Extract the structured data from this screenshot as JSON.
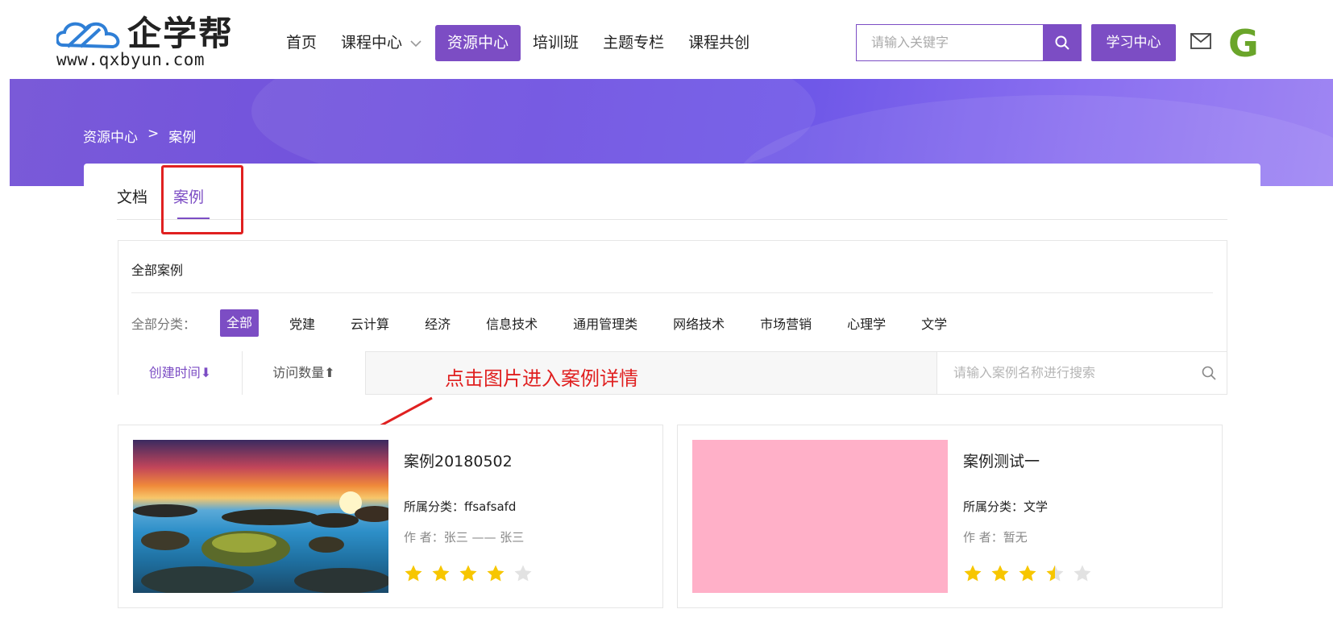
{
  "header": {
    "logo_text": "企学帮",
    "logo_url": "www.qxbyun.com",
    "nav": [
      {
        "label": "首页",
        "active": false
      },
      {
        "label": "课程中心",
        "active": false,
        "dropdown": true
      },
      {
        "label": "资源中心",
        "active": true
      },
      {
        "label": "培训班",
        "active": false
      },
      {
        "label": "主题专栏",
        "active": false
      },
      {
        "label": "课程共创",
        "active": false
      }
    ],
    "search_placeholder": "请输入关键字",
    "study_center_label": "学习中心",
    "avatar_letter": "G"
  },
  "breadcrumb": {
    "root": "资源中心",
    "separator": ">",
    "current": "案例"
  },
  "tabs": [
    {
      "label": "文档",
      "active": false
    },
    {
      "label": "案例",
      "active": true
    }
  ],
  "filter": {
    "title": "全部案例",
    "category_label": "全部分类：",
    "categories": [
      "全部",
      "党建",
      "云计算",
      "经济",
      "信息技术",
      "通用管理类",
      "网络技术",
      "市场营销",
      "心理学",
      "文学"
    ],
    "active_category": "全部"
  },
  "sort": {
    "created_time": "创建时间⬇",
    "visit_count": "访问数量⬆",
    "search_placeholder": "请输入案例名称进行搜索"
  },
  "annotation": {
    "text": "点击图片进入案例详情",
    "color": "#e02020"
  },
  "cases": [
    {
      "title": "案例20180502",
      "category": "所属分类：ffsafsafd",
      "author": "作 者：张三 —— 张三",
      "rating": 4,
      "thumbnail": "sunset-landscape-image"
    },
    {
      "title": "案例测试一",
      "category": "所属分类：文学",
      "author": "作 者：暂无",
      "rating": 3.5,
      "thumbnail": "pink-placeholder"
    }
  ],
  "colors": {
    "accent": "#7c4dc4",
    "star": "#f7c600",
    "star_empty": "#e2e2e2"
  }
}
